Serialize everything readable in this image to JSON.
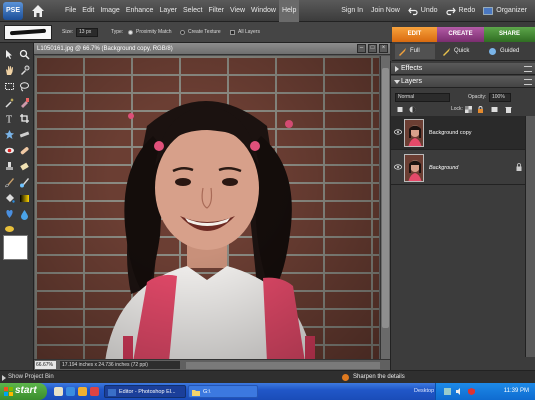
{
  "app": {
    "logo_text": "PSE",
    "menu": [
      "File",
      "Edit",
      "Image",
      "Enhance",
      "Layer",
      "Select",
      "Filter",
      "View",
      "Window",
      "Help"
    ],
    "active_menu": "Help",
    "right_menu": {
      "sign_in": "Sign In",
      "join_now": "Join Now",
      "undo": "Undo",
      "redo": "Redo",
      "organizer": "Organizer"
    }
  },
  "options": {
    "size_label": "Size:",
    "size_value": "13 px",
    "type_label": "Type:",
    "proximity_match": "Proximity Match",
    "create_texture": "Create Texture",
    "all_layers": "All Layers"
  },
  "mode_tabs": {
    "edit": "EDIT",
    "create": "CREATE",
    "share": "SHARE"
  },
  "sub_tabs": {
    "full": "Full",
    "quick": "Quick",
    "guided": "Guided"
  },
  "document": {
    "title": "L1050161.jpg @ 66.7% (Background copy, RGB/8)",
    "zoom": "66.67%",
    "info": "17.194 inches x 24.736 inches (72 ppi)"
  },
  "panels": {
    "effects": "Effects",
    "layers": "Layers",
    "blend_mode": "Normal",
    "opacity_label": "Opacity:",
    "opacity_value": "100%",
    "lock_label": "Lock:",
    "layer_items": [
      {
        "name": "Background copy",
        "selected": true,
        "locked": false
      },
      {
        "name": "Background",
        "selected": false,
        "locked": true
      }
    ]
  },
  "project_bin": {
    "label": "Show Project Bin",
    "tip": "Sharpen the details"
  },
  "taskbar": {
    "start": "start",
    "tasks": [
      {
        "label": "Editor - Photoshop El...",
        "active": true
      },
      {
        "label": "G:\\",
        "active": false
      }
    ],
    "desktop": "Desktop",
    "clock": "11:39 PM"
  },
  "colors": {
    "edit_tab": "#d96a0f",
    "create_tab": "#7a2d6f",
    "share_tab": "#2f6d22",
    "foreground": "#ffffff",
    "background": "#ffffff"
  },
  "icons": [
    "home-icon",
    "undo-icon",
    "redo-icon",
    "organizer-icon",
    "eye-icon",
    "lock-icon",
    "panel-menu-icon",
    "windows-flag-icon"
  ]
}
